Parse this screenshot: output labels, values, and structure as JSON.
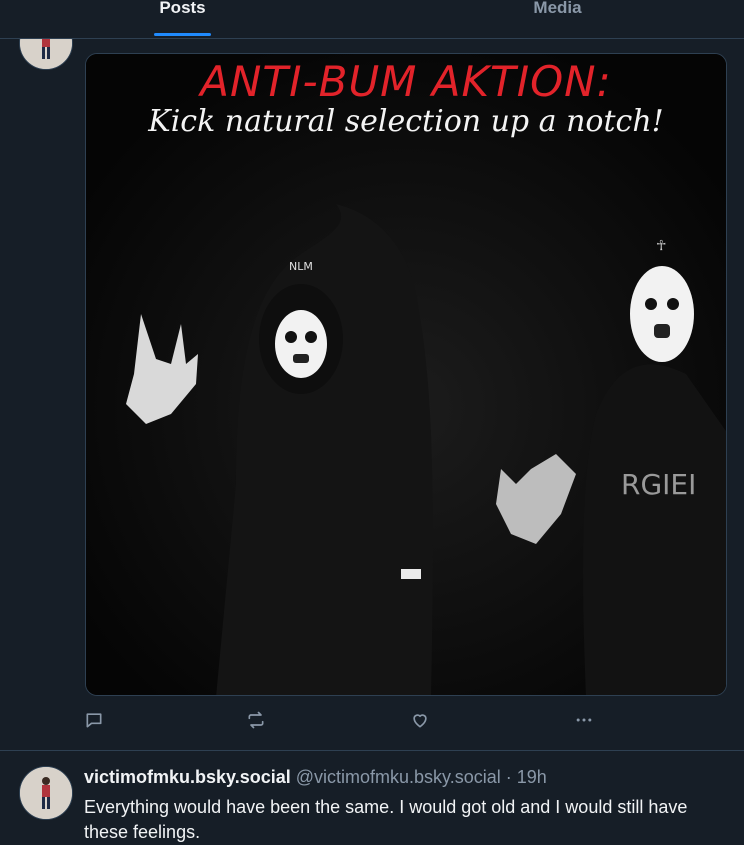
{
  "tabs": [
    {
      "label": "Posts",
      "active": true
    },
    {
      "label": "Media",
      "active": false
    }
  ],
  "post1": {
    "image": {
      "title": "ANTI-BUM AKTION:",
      "subtitle": "Kick natural selection up a notch!",
      "mask_text": "NLM",
      "shirt_text": "RGIEI"
    },
    "actions": [
      "reply-icon",
      "repost-icon",
      "like-icon",
      "more-icon"
    ]
  },
  "post2": {
    "display_name": "victimofmku.bsky.social",
    "handle": "@victimofmku.bsky.social",
    "separator": "·",
    "time": "19h",
    "text": "Everything would have been the same. I would got old and I would still have these feelings."
  },
  "colors": {
    "background": "#161e27",
    "accent": "#208bfe",
    "border": "#2e4052",
    "muted": "#8a98a8",
    "title_red": "#e2232a"
  }
}
